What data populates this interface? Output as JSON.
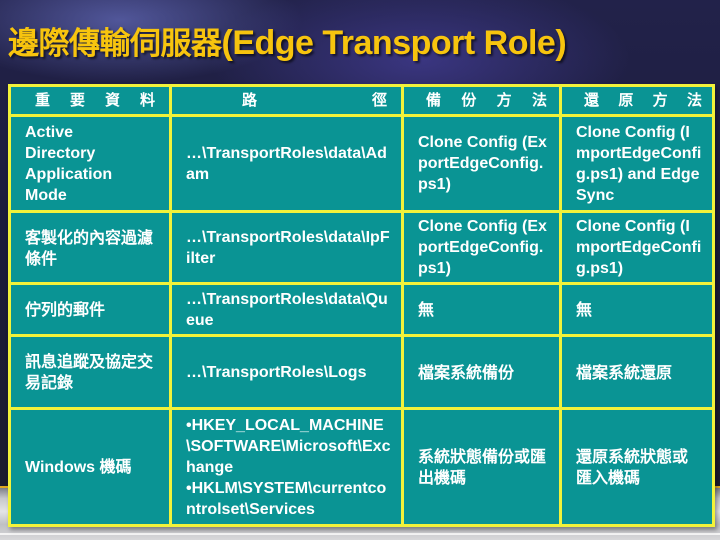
{
  "slide": {
    "title_cjk": "邊際傳輸伺服器",
    "title_en": "(Edge Transport Role)"
  },
  "table": {
    "headers": [
      {
        "chars": [
          "重",
          "要",
          "資",
          "料"
        ]
      },
      {
        "chars": [
          "路",
          "徑"
        ]
      },
      {
        "chars": [
          "備",
          "份",
          "方",
          "法"
        ]
      },
      {
        "chars": [
          "還",
          "原",
          "方",
          "法"
        ]
      }
    ],
    "rows": [
      {
        "data": "Active Directory Application Mode",
        "path": "…\\TransportRoles\\data\\Adam",
        "backup": "Clone Config (ExportEdgeConfig.ps1)",
        "restore": "Clone Config (ImportEdgeConfig.ps1) and EdgeSync"
      },
      {
        "data": "客製化的內容過濾條件",
        "path": "…\\TransportRoles\\data\\IpFilter",
        "backup": "Clone Config (ExportEdgeConfig.ps1)",
        "restore": "Clone Config (ImportEdgeConfig.ps1)"
      },
      {
        "data": "佇列的郵件",
        "path": "…\\TransportRoles\\data\\Queue",
        "backup": "無",
        "restore": "無"
      },
      {
        "data": "訊息追蹤及協定交易記錄",
        "path": "…\\TransportRoles\\Logs",
        "backup": "檔案系統備份",
        "restore": "檔案系統還原"
      },
      {
        "data": "Windows 機碼",
        "path_lines": [
          "•HKEY_LOCAL_MACHINE\\SOFTWARE\\Microsoft\\Exchange",
          "•HKLM\\SYSTEM\\currentcontrolset\\Services"
        ],
        "backup": "系統狀態備份或匯出機碼",
        "restore": "還原系統狀態或匯入機碼"
      }
    ]
  },
  "colors": {
    "title": "#f7c40e",
    "table_fill": "#0a9494",
    "grid_lines": "#f2f23a",
    "cell_text": "#ffffff"
  }
}
